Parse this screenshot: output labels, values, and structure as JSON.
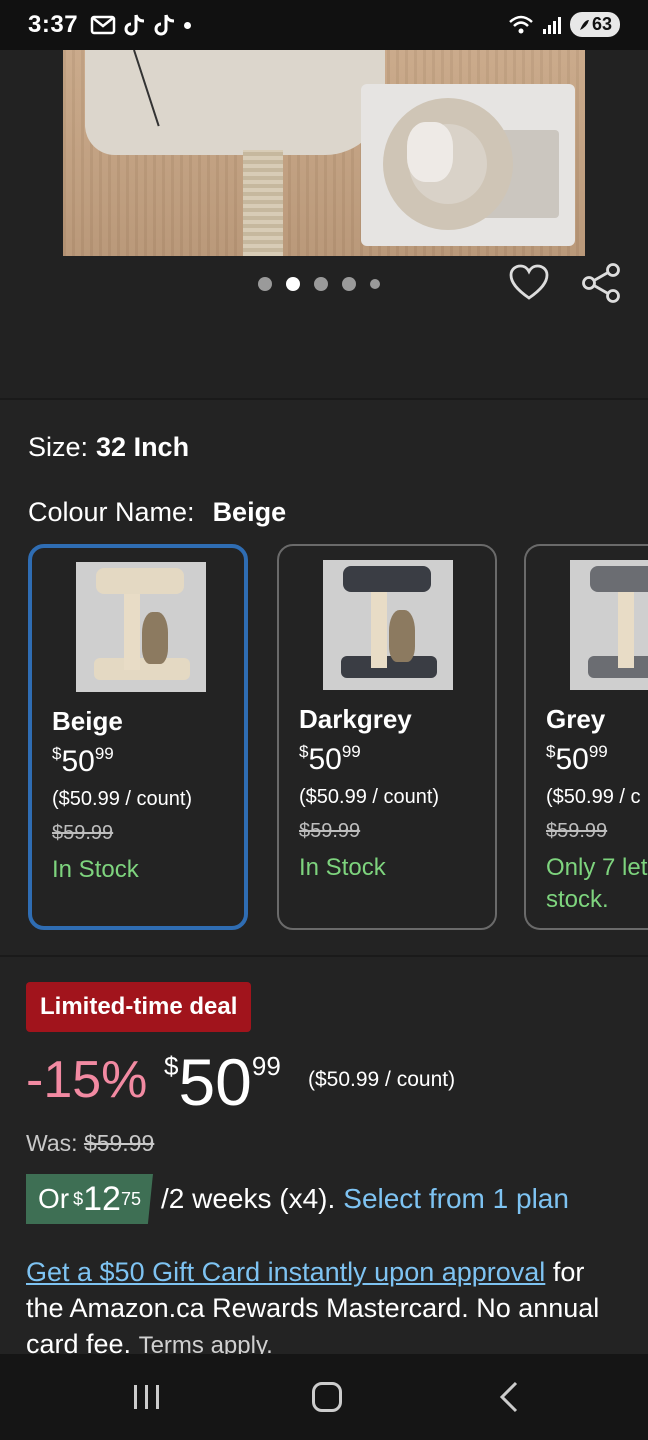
{
  "status_bar": {
    "time": "3:37",
    "battery": "63",
    "icons": [
      "mail-icon",
      "tiktok-icon",
      "tiktok-icon",
      "dot-icon",
      "wifi-icon",
      "signal-icon",
      "battery-icon"
    ]
  },
  "gallery": {
    "page_count": 5,
    "active_index": 1
  },
  "size": {
    "label": "Size:",
    "value": "32 Inch"
  },
  "colour": {
    "label": "Colour Name:",
    "value": "Beige"
  },
  "swatches": [
    {
      "name": "Beige",
      "currency": "$",
      "dollars": "50",
      "cents": "99",
      "unit": "($50.99 / count)",
      "was": "$59.99",
      "stock": "In Stock",
      "bed_color": "#e4d9c3",
      "base_color": "#e4d9c3"
    },
    {
      "name": "Darkgrey",
      "currency": "$",
      "dollars": "50",
      "cents": "99",
      "unit": "($50.99 / count)",
      "was": "$59.99",
      "stock": "In Stock",
      "bed_color": "#3a3d44",
      "base_color": "#3a3d44"
    },
    {
      "name": "Grey",
      "currency": "$",
      "dollars": "50",
      "cents": "99",
      "unit": "($50.99 / c",
      "was": "$59.99",
      "stock": "Only 7 let stock.",
      "bed_color": "#6b6d72",
      "base_color": "#6b6d72"
    }
  ],
  "deal": {
    "badge": "Limited-time deal",
    "percent": "-15%",
    "currency": "$",
    "dollars": "50",
    "cents": "99",
    "unit": "($50.99 / count)",
    "was_label": "Was:",
    "was_value": "$59.99"
  },
  "installment": {
    "prefix": "Or",
    "currency": "$",
    "dollars": "12",
    "cents": "75",
    "text": "/2 weeks (x4).",
    "link": "Select from 1 plan"
  },
  "promo": {
    "link": "Get a $50 Gift Card instantly upon approval",
    "text": "for the Amazon.ca Rewards Mastercard. No annual card fee.",
    "terms": "Terms apply."
  },
  "colors": {
    "selected_border": "#2f6db3",
    "in_stock": "#7ed47e",
    "deal_badge": "#a1141c",
    "discount": "#f28aa2",
    "link": "#7ec3f2",
    "installment_badge": "#3e6f54"
  }
}
